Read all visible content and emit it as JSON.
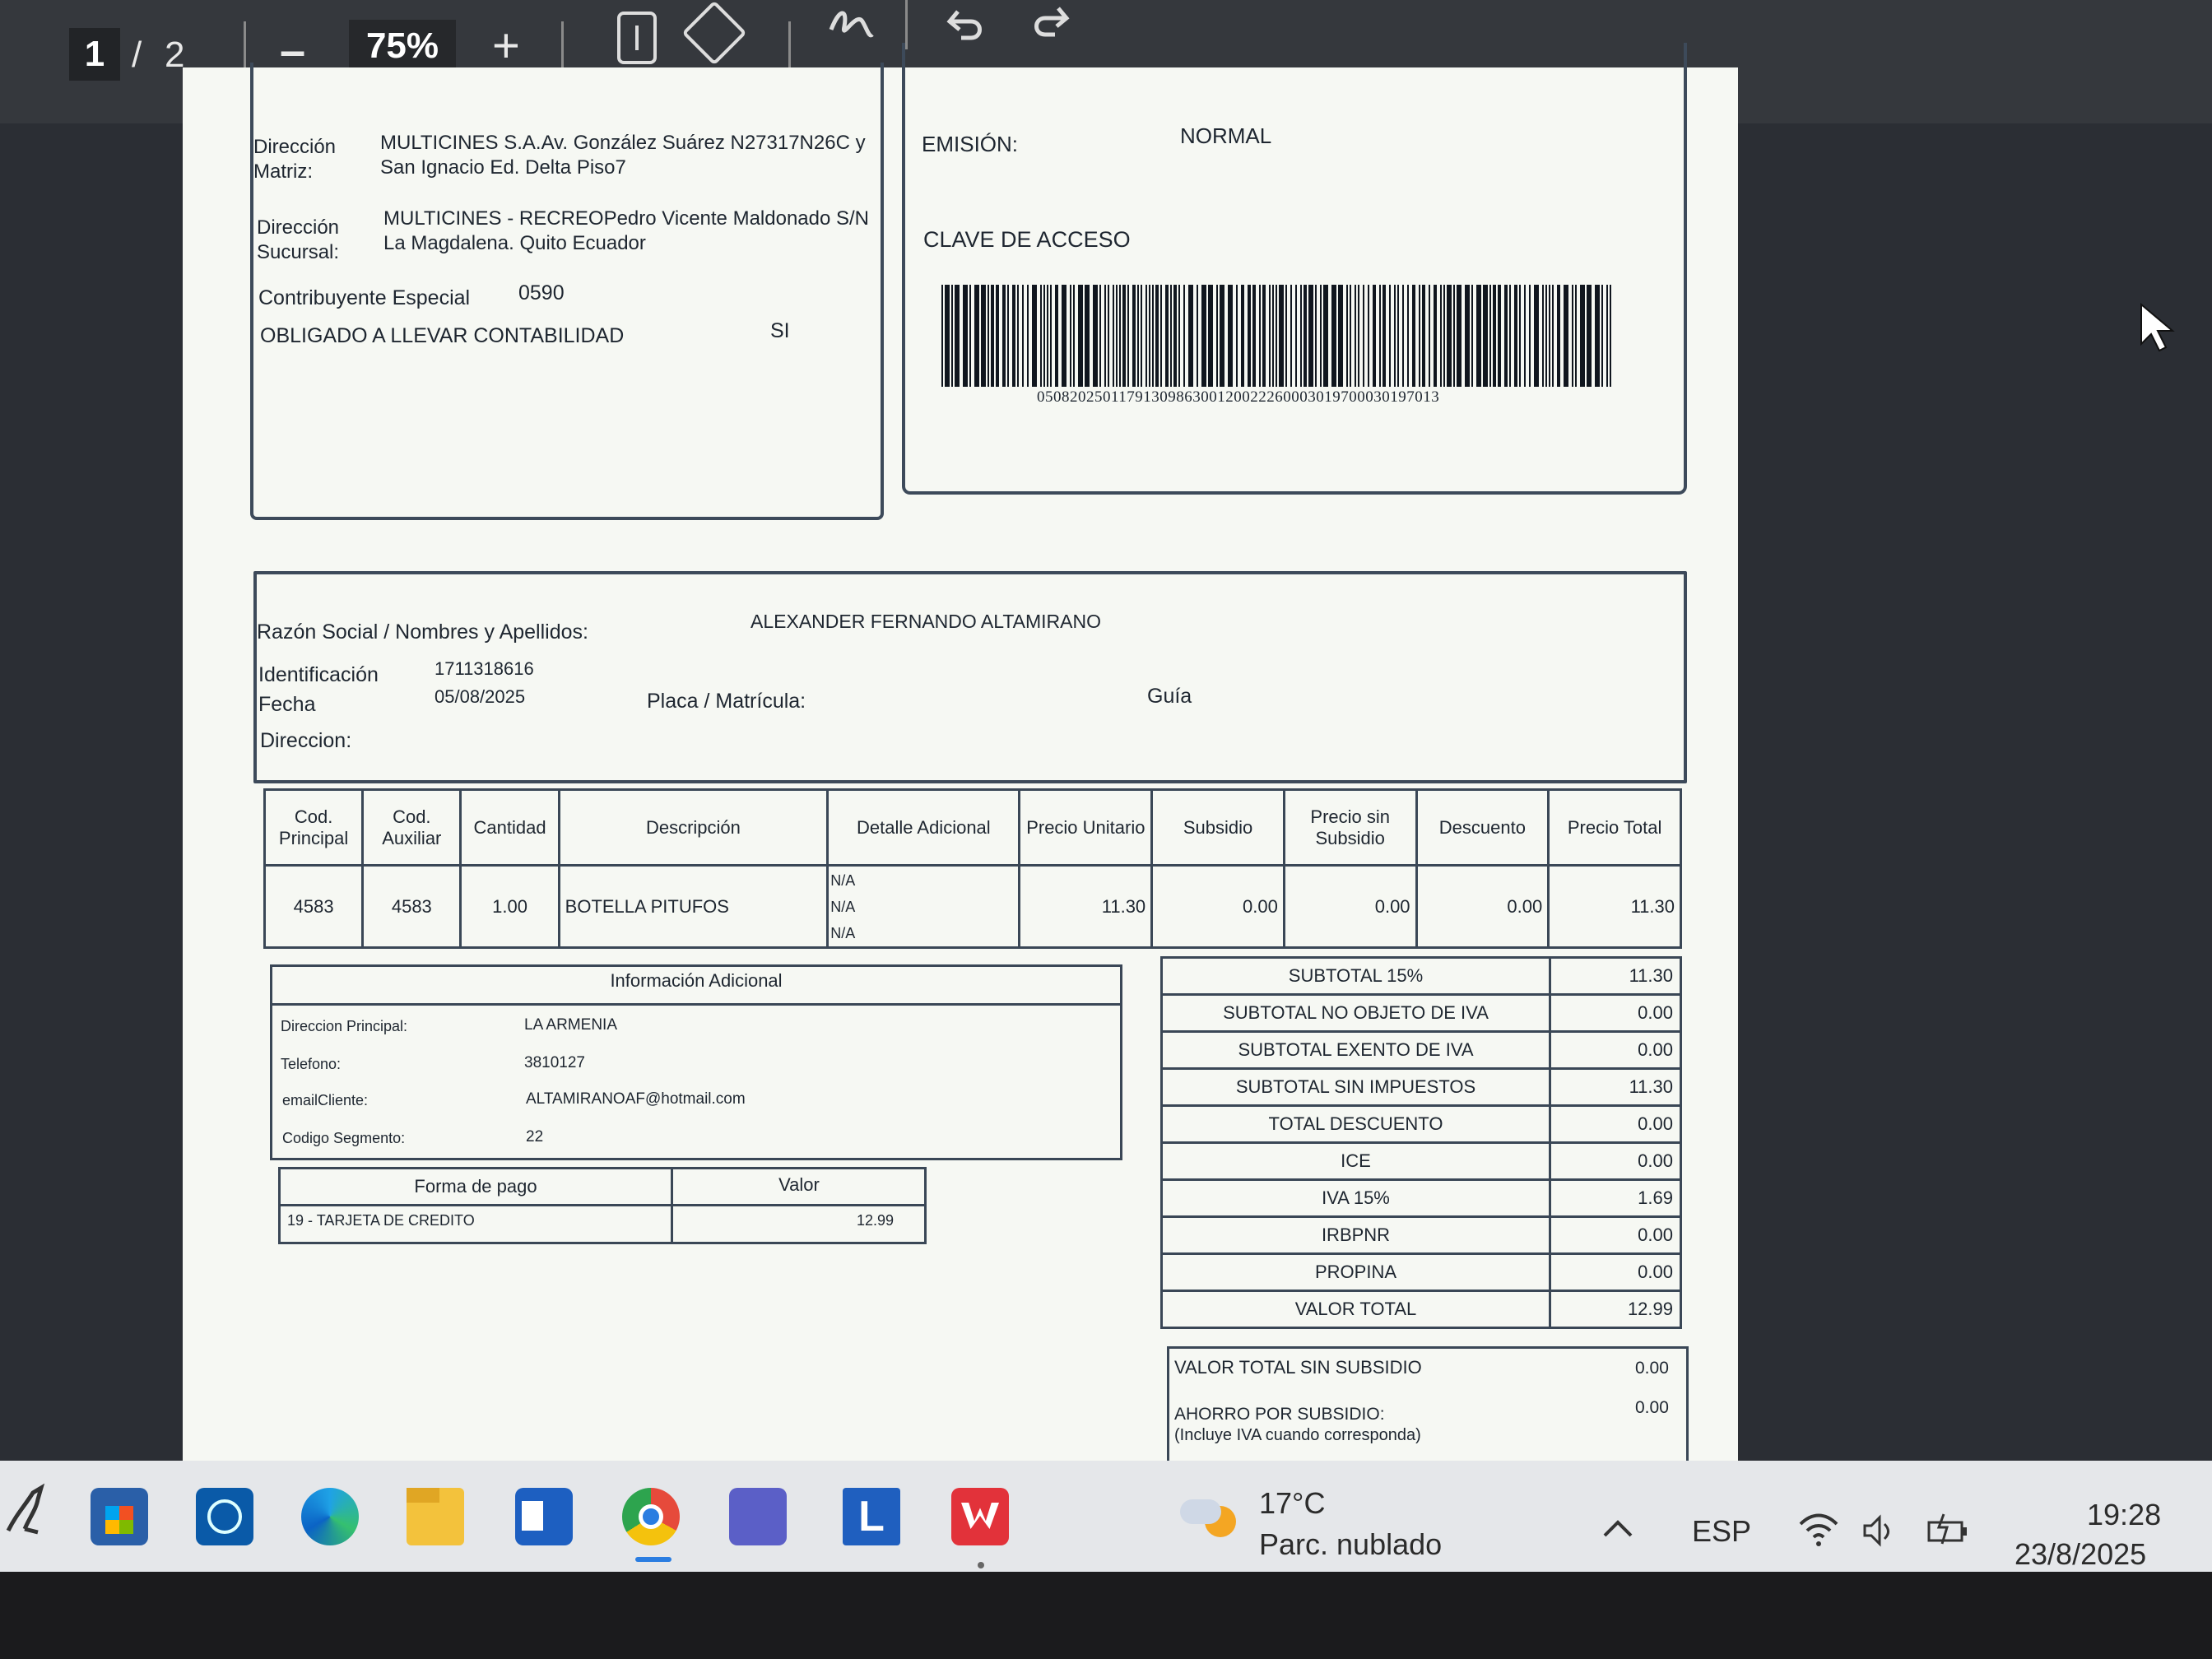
{
  "toolbar": {
    "current_page": "1",
    "page_sep": "/",
    "total_pages": "2",
    "zoom_out": "–",
    "zoom": "75%",
    "zoom_in": "+"
  },
  "header_left": {
    "dir_matriz_label": "Dirección Matriz:",
    "dir_matriz_value_1": "MULTICINES S.A.Av. González Suárez N27317N26C y",
    "dir_matriz_value_2": "San Ignacio Ed. Delta Piso7",
    "dir_sucursal_label": "Dirección Sucursal:",
    "dir_sucursal_value_1": "MULTICINES - RECREOPedro Vicente Maldonado S/N",
    "dir_sucursal_value_2": "La Magdalena. Quito Ecuador",
    "contrib_label": "Contribuyente Especial",
    "contrib_value": "0590",
    "obligado_label": "OBLIGADO A LLEVAR CONTABILIDAD",
    "obligado_value": "SI"
  },
  "header_right": {
    "emision_label": "EMISIÓN:",
    "emision_value": "NORMAL",
    "clave_label": "CLAVE DE ACCESO",
    "barcode_number": "0508202501179130986300120022260003019700030197013"
  },
  "client": {
    "razon_label": "Razón Social / Nombres y Apellidos:",
    "razon_value": "ALEXANDER FERNANDO ALTAMIRANO",
    "id_label": "Identificación",
    "id_value": "1711318616",
    "fecha_label": "Fecha",
    "fecha_value": "05/08/2025",
    "placa_label": "Placa / Matrícula:",
    "guia_label": "Guía",
    "direccion_label": "Direccion:"
  },
  "items": {
    "headers": [
      "Cod. Principal",
      "Cod. Auxiliar",
      "Cantidad",
      "Descripción",
      "Detalle Adicional",
      "Precio Unitario",
      "Subsidio",
      "Precio sin Subsidio",
      "Descuento",
      "Precio Total"
    ],
    "rows": [
      {
        "cod_principal": "4583",
        "cod_auxiliar": "4583",
        "cantidad": "1.00",
        "descripcion": "BOTELLA PITUFOS",
        "detalle_1": "N/A",
        "detalle_2": "N/A",
        "detalle_3": "N/A",
        "precio_unitario": "11.30",
        "subsidio": "0.00",
        "precio_sin_subsidio": "0.00",
        "descuento": "0.00",
        "precio_total": "11.30"
      }
    ]
  },
  "info_adicional": {
    "title": "Información Adicional",
    "rows": [
      {
        "label": "Direccion Principal:",
        "value": "LA ARMENIA"
      },
      {
        "label": "Telefono:",
        "value": "3810127"
      },
      {
        "label": "emailCliente:",
        "value": "ALTAMIRANOAF@hotmail.com"
      },
      {
        "label": "Codigo Segmento:",
        "value": "22"
      }
    ]
  },
  "pago": {
    "col_forma": "Forma de pago",
    "col_valor": "Valor",
    "forma": "19 - TARJETA DE CREDITO",
    "valor": "12.99"
  },
  "totals": [
    {
      "label": "SUBTOTAL 15%",
      "value": "11.30"
    },
    {
      "label": "SUBTOTAL NO OBJETO DE IVA",
      "value": "0.00"
    },
    {
      "label": "SUBTOTAL EXENTO DE IVA",
      "value": "0.00"
    },
    {
      "label": "SUBTOTAL SIN IMPUESTOS",
      "value": "11.30"
    },
    {
      "label": "TOTAL DESCUENTO",
      "value": "0.00"
    },
    {
      "label": "ICE",
      "value": "0.00"
    },
    {
      "label": "IVA 15%",
      "value": "1.69"
    },
    {
      "label": "IRBPNR",
      "value": "0.00"
    },
    {
      "label": "PROPINA",
      "value": "0.00"
    },
    {
      "label": "VALOR TOTAL",
      "value": "12.99"
    }
  ],
  "subsidio_box": {
    "valor_sin_subsidio_label": "VALOR TOTAL SIN SUBSIDIO",
    "valor_sin_subsidio_value": "0.00",
    "ahorro_label": "AHORRO POR SUBSIDIO:",
    "ahorro_note": "(Incluye IVA cuando corresponda)",
    "ahorro_value": "0.00"
  },
  "taskbar": {
    "weather_temp": "17°C",
    "weather_desc": "Parc. nublado",
    "lang": "ESP",
    "time": "19:28",
    "date": "23/8/2025",
    "launcher_letter": "L"
  },
  "colors": {
    "viewer_bg": "#2b2e34",
    "toolbar_bg": "#35383d",
    "page_bg": "#f6f8f3",
    "taskbar_bg": "#e5e7ea",
    "ink": "#1e2630",
    "wps_red": "#e2323a",
    "launcher_blue": "#1f5fbf"
  }
}
